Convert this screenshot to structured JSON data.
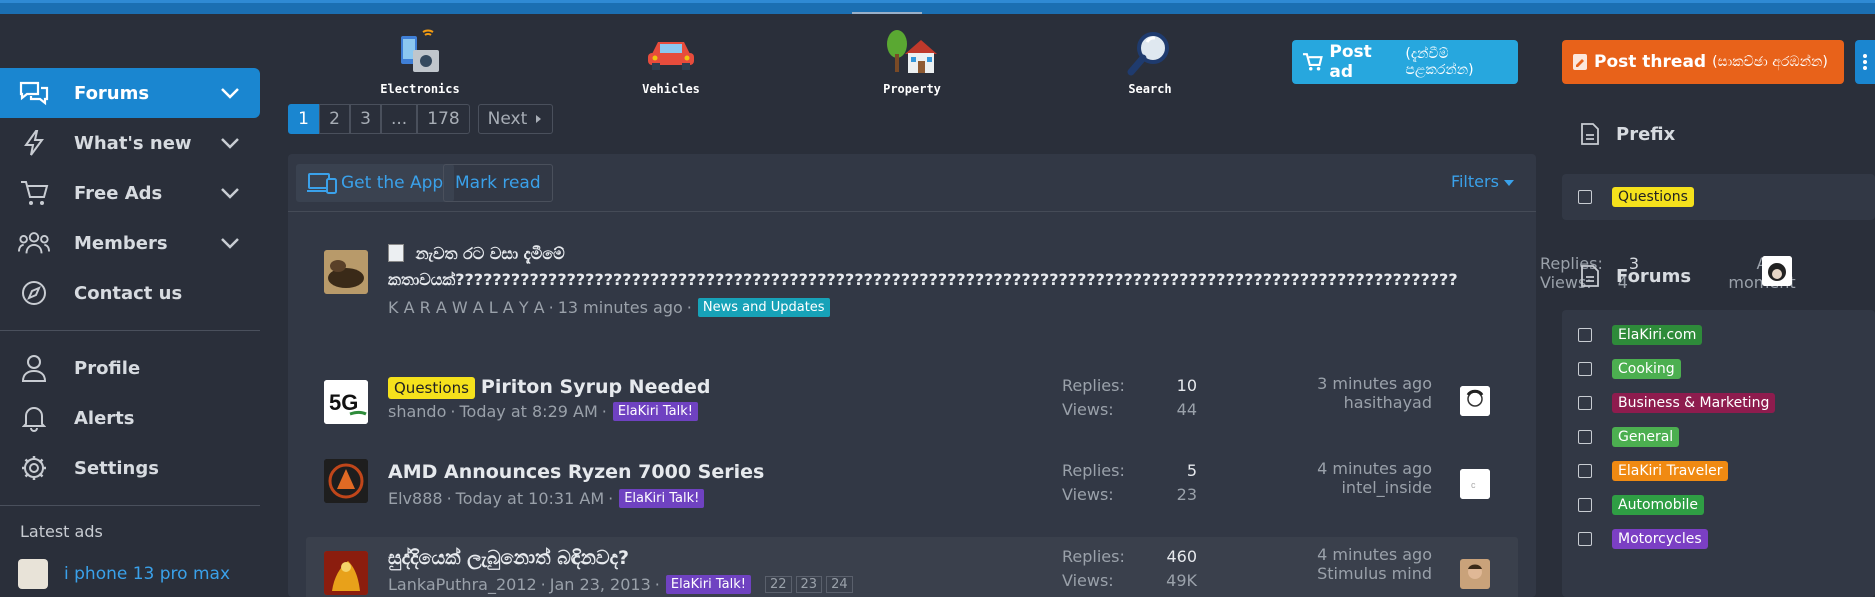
{
  "nav": {
    "items": [
      {
        "label": "Forums",
        "active": true,
        "icon": "chat-bubbles-icon"
      },
      {
        "label": "What's new",
        "icon": "lightning-icon"
      },
      {
        "label": "Free Ads",
        "icon": "cart-icon"
      },
      {
        "label": "Members",
        "icon": "users-icon"
      },
      {
        "label": "Contact us",
        "icon": "compass-icon"
      }
    ],
    "account": [
      {
        "label": "Profile",
        "icon": "person-icon"
      },
      {
        "label": "Alerts",
        "icon": "bell-icon"
      },
      {
        "label": "Settings",
        "icon": "gear-icon"
      }
    ],
    "latest_ads_title": "Latest ads",
    "latest_ads": [
      {
        "label": "i phone 13 pro max"
      }
    ]
  },
  "categories": [
    {
      "label": "Electronics",
      "icon": "electronics-icon"
    },
    {
      "label": "Vehicles",
      "icon": "car-icon"
    },
    {
      "label": "Property",
      "icon": "house-icon"
    },
    {
      "label": "Search",
      "icon": "magnifier-icon"
    }
  ],
  "actions": {
    "post_ad": "Post ad",
    "post_ad_sub": "(දැන්වීම් පළකරන්න)",
    "post_thread": "Post thread",
    "post_thread_sub": "(සාකච්ඡා අරඹන්න)"
  },
  "pagination": {
    "pages": [
      "1",
      "2",
      "3",
      "...",
      "178"
    ],
    "current": "1",
    "next_label": "Next"
  },
  "toolbar": {
    "get_app": "Get the App",
    "mark_read": "Mark read",
    "filters": "Filters"
  },
  "threads": [
    {
      "title_line1": "නැවත රට වසා දැමීමේ",
      "title_line2": "කතාවයක්????????????????????????????????????????????????????????????????????????????????????????????????????????????",
      "author": "K A R A W A L A Y A",
      "time": "13 minutes ago",
      "tag": "News and Updates",
      "tag_color": "#17a2b8"
    },
    {
      "prefix": "Questions",
      "title": "Piriton Syrup Needed",
      "author": "shando",
      "time": "Today at 8:29 AM",
      "tag": "ElaKiri Talk!",
      "tag_color": "#6f42c1",
      "replies_label": "Replies:",
      "replies": "10",
      "views_label": "Views:",
      "views": "44",
      "last_time": "3 minutes ago",
      "last_user": "hasithayad"
    },
    {
      "title": "AMD Announces Ryzen 7000 Series",
      "author": "Elv888",
      "time": "Today at 10:31 AM",
      "tag": "ElaKiri Talk!",
      "tag_color": "#6f42c1",
      "replies_label": "Replies:",
      "replies": "5",
      "views_label": "Views:",
      "views": "23",
      "last_time": "4 minutes ago",
      "last_user": "intel_inside"
    },
    {
      "title": "සුද්දියෙක් ලැබුනොත් බඳිනවද?",
      "author": "LankaPuthra_2012",
      "time": "Jan 23, 2013",
      "tag": "ElaKiri Talk!",
      "tag_color": "#6f42c1",
      "pages": [
        "22",
        "23",
        "24"
      ],
      "replies_label": "Replies:",
      "replies": "460",
      "views_label": "Views:",
      "views": "49K",
      "last_time": "4 minutes ago",
      "last_user": "Stimulus mind"
    }
  ],
  "overlay": {
    "replies_label": "Replies:",
    "replies": "3",
    "views_label": "Views:",
    "views": "4",
    "last_time_a": "A",
    "last_time_b": "moment"
  },
  "right": {
    "prefix_title": "Prefix",
    "prefixes": [
      {
        "label": "Questions",
        "color": "#f5e11c",
        "text_color": "#222222"
      }
    ],
    "forums_title": "Forums",
    "forums": [
      {
        "label": "ElaKiri.com",
        "color": "#2e8b3a"
      },
      {
        "label": "Cooking",
        "color": "#4caf50"
      },
      {
        "label": "Business & Marketing",
        "color": "#8e1c4e"
      },
      {
        "label": "General",
        "color": "#4caf50"
      },
      {
        "label": "ElaKiri Traveler",
        "color": "#f08a12"
      },
      {
        "label": "Automobile",
        "color": "#2f9e44"
      },
      {
        "label": "Motorcycles",
        "color": "#7b3fc4"
      }
    ]
  }
}
